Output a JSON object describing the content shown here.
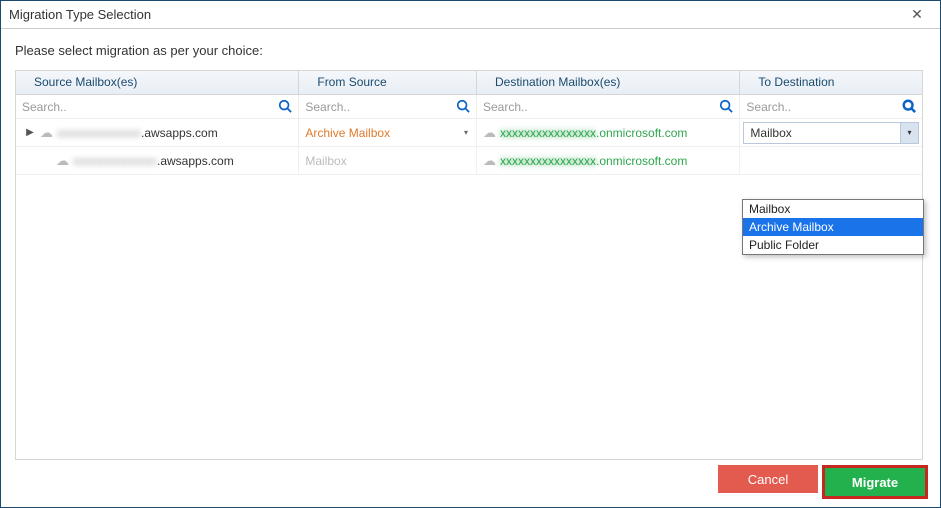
{
  "window": {
    "title": "Migration Type Selection",
    "close_glyph": "✕"
  },
  "prompt": "Please select migration as per your choice:",
  "columns": {
    "source_mailbox": "Source Mailbox(es)",
    "from_source": "From Source",
    "destination_mailbox": "Destination Mailbox(es)",
    "to_destination": "To Destination"
  },
  "search": {
    "placeholder": "Search.."
  },
  "rows": [
    {
      "source_blur": "xxxxxxxxxxxxxx",
      "source_suffix": ".awsapps.com",
      "from_source": "Archive Mailbox",
      "from_style": "orange",
      "dest_blur": "xxxxxxxxxxxxxxxx",
      "dest_suffix": ".onmicrosoft.com",
      "to_dest": "Mailbox",
      "to_dest_mode": "dropdown",
      "expandable": true
    },
    {
      "source_blur": "xxxxxxxxxxxxxx",
      "source_suffix": ".awsapps.com",
      "from_source": "Mailbox",
      "from_style": "gray",
      "dest_blur": "xxxxxxxxxxxxxxxx",
      "dest_suffix": ".onmicrosoft.com",
      "to_dest": "",
      "to_dest_mode": "none",
      "expandable": false
    }
  ],
  "dropdown": {
    "options": [
      "Mailbox",
      "Archive Mailbox",
      "Public Folder"
    ],
    "selected_index": 1
  },
  "buttons": {
    "cancel": "Cancel",
    "migrate": "Migrate"
  }
}
